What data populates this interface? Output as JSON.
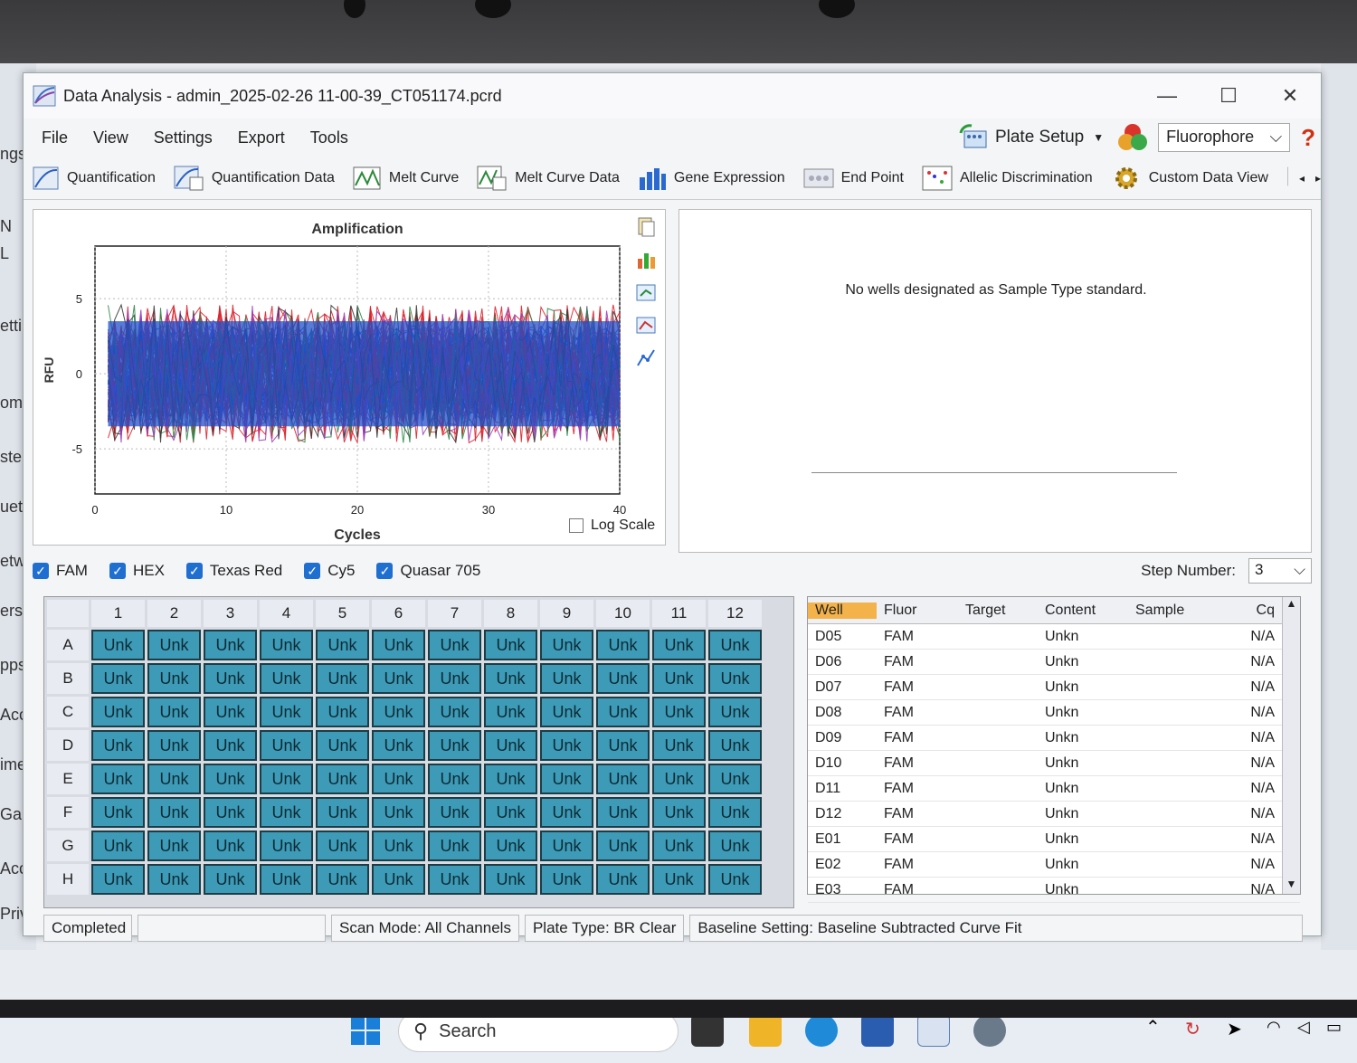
{
  "window": {
    "title": "Data Analysis - admin_2025-02-26 11-00-39_CT051174.pcrd",
    "controls": [
      "—",
      "☐",
      "✕"
    ]
  },
  "menu": [
    "File",
    "View",
    "Settings",
    "Export",
    "Tools"
  ],
  "plate_setup": "Plate Setup",
  "fluorophore_select": "Fluorophore",
  "toolbar": [
    "Quantification",
    "Quantification Data",
    "Melt Curve",
    "Melt Curve Data",
    "Gene Expression",
    "End Point",
    "Allelic Discrimination",
    "Custom Data View"
  ],
  "chart_data": {
    "type": "line",
    "title": "Amplification",
    "xlabel": "Cycles",
    "ylabel": "RFU",
    "xlim": [
      0,
      40
    ],
    "ylim": [
      -8,
      8.5
    ],
    "xticks": [
      0,
      10,
      20,
      30,
      40
    ],
    "yticks": [
      5,
      0,
      -5
    ],
    "series_colors": [
      "#1f4fc8",
      "#d9232e",
      "#9b3fbf",
      "#2d8a4a",
      "#3a3a3a"
    ],
    "band_upper": 3.5,
    "band_lower": -3.5,
    "note_series": "noise traces around 0 for all wells"
  },
  "log_scale_label": "Log Scale",
  "standard_message": "No wells designated as Sample Type standard.",
  "fluor_checks": [
    "FAM",
    "HEX",
    "Texas Red",
    "Cy5",
    "Quasar 705"
  ],
  "step": {
    "label": "Step Number:",
    "value": "3"
  },
  "plate": {
    "columns": [
      "1",
      "2",
      "3",
      "4",
      "5",
      "6",
      "7",
      "8",
      "9",
      "10",
      "11",
      "12"
    ],
    "rows": [
      "A",
      "B",
      "C",
      "D",
      "E",
      "F",
      "G",
      "H"
    ],
    "cell": "Unk"
  },
  "grid": {
    "headers": [
      "Well",
      "Fluor",
      "Target",
      "Content",
      "Sample",
      "Cq"
    ],
    "rows": [
      [
        "D05",
        "FAM",
        "",
        "Unkn",
        "",
        "N/A"
      ],
      [
        "D06",
        "FAM",
        "",
        "Unkn",
        "",
        "N/A"
      ],
      [
        "D07",
        "FAM",
        "",
        "Unkn",
        "",
        "N/A"
      ],
      [
        "D08",
        "FAM",
        "",
        "Unkn",
        "",
        "N/A"
      ],
      [
        "D09",
        "FAM",
        "",
        "Unkn",
        "",
        "N/A"
      ],
      [
        "D10",
        "FAM",
        "",
        "Unkn",
        "",
        "N/A"
      ],
      [
        "D11",
        "FAM",
        "",
        "Unkn",
        "",
        "N/A"
      ],
      [
        "D12",
        "FAM",
        "",
        "Unkn",
        "",
        "N/A"
      ],
      [
        "E01",
        "FAM",
        "",
        "Unkn",
        "",
        "N/A"
      ],
      [
        "E02",
        "FAM",
        "",
        "Unkn",
        "",
        "N/A"
      ],
      [
        "E03",
        "FAM",
        "",
        "Unkn",
        "",
        "N/A"
      ]
    ]
  },
  "status": [
    "Completed",
    "",
    "Scan Mode: All Channels",
    "Plate Type: BR Clear",
    "Baseline Setting: Baseline Subtracted Curve Fit"
  ],
  "taskbar": {
    "search": "Search"
  },
  "background_left": [
    "ngs",
    "N",
    "L",
    "etti",
    "ome",
    "ster",
    "uetc",
    "etw",
    "erso",
    "pps",
    "Accou",
    "ime",
    "Gami",
    "Acces",
    "Privac",
    "ers"
  ]
}
